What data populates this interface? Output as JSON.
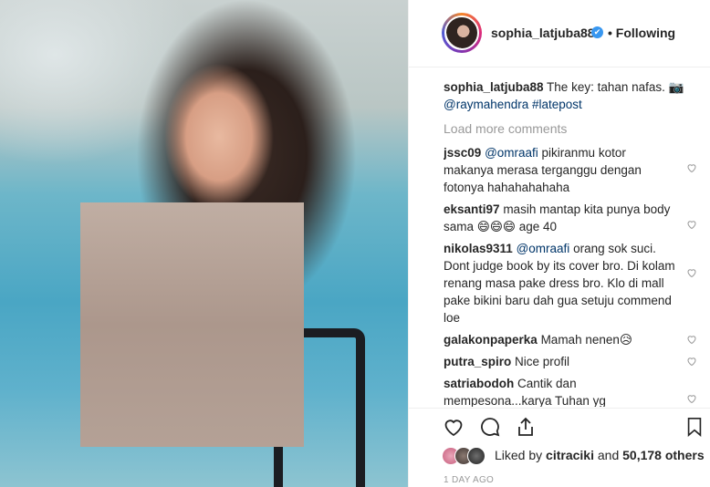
{
  "post": {
    "username": "sophia_latjuba88",
    "verified_mark": "✔",
    "following": "• Following"
  },
  "caption": {
    "username": "sophia_latjuba88",
    "text": " The key: tahan nafas. 📷",
    "mention1": "@raymahendra",
    "tag": " #latepost"
  },
  "load_more": "Load more comments",
  "comments": [
    {
      "user": "jssc09",
      "mention": "@omraafi",
      "text": " pikiranmu kotor makanya merasa terganggu dengan fotonya hahahahahaha"
    },
    {
      "user": "eksanti97",
      "mention": "",
      "text": "masih mantap kita punya body sama 😄😄😄 age 40"
    },
    {
      "user": "nikolas9311",
      "mention": "@omraafi",
      "text": " orang sok suci. Dont judge book by its cover bro. Di kolam renang masa pake dress bro. Klo di mall pake bikini baru dah gua setuju commend loe"
    },
    {
      "user": "galakonpaperka",
      "mention": "",
      "text": "Mamah nenen😥"
    },
    {
      "user": "putra_spiro",
      "mention": "",
      "text": "Nice profil"
    },
    {
      "user": "satriabodoh",
      "mention": "",
      "text": "Cantik dan mempesona...karya Tuhan yg"
    }
  ],
  "likes": {
    "prefix": "Liked by ",
    "user": "citraciki",
    "middle": " and ",
    "count": "50,178 others"
  },
  "timestamp": "1 DAY AGO",
  "icons": {
    "like": "heart-icon",
    "comment": "comment-icon",
    "share": "share-icon",
    "save": "bookmark-icon"
  },
  "colors": {
    "verified": "#3897f0",
    "mention": "#003569",
    "muted": "#999999"
  }
}
